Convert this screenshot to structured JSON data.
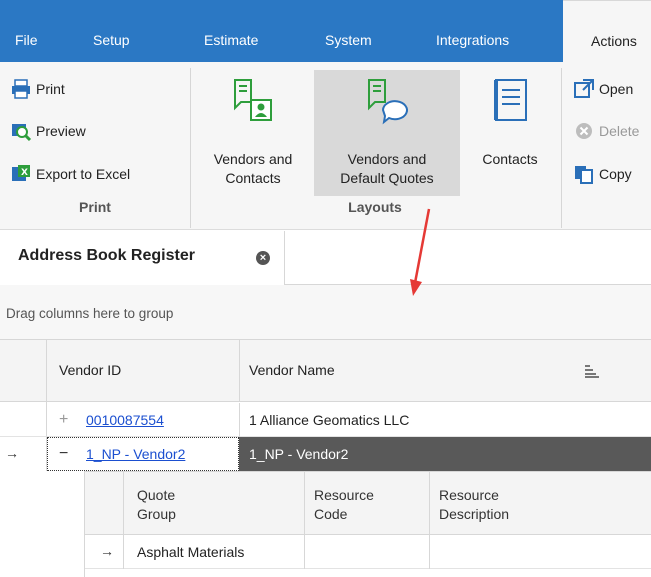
{
  "menu": {
    "items": [
      "File",
      "Setup",
      "Estimate",
      "System",
      "Integrations",
      "Actions"
    ],
    "active": "Actions"
  },
  "ribbon": {
    "print_group": {
      "buttons": [
        "Print",
        "Preview",
        "Export to Excel"
      ],
      "label": "Print"
    },
    "layouts_group": {
      "buttons": [
        "Vendors and\nContacts",
        "Vendors and\nDefault Quotes",
        "Contacts"
      ],
      "label": "Layouts"
    },
    "actions_group": {
      "buttons": [
        "Open",
        "Delete",
        "Copy"
      ]
    }
  },
  "document_tab": {
    "title": "Address Book Register",
    "close_icon": "close-icon"
  },
  "group_panel": {
    "placeholder": "Drag columns here to group"
  },
  "grid": {
    "columns": [
      "Vendor ID",
      "Vendor Name"
    ],
    "rows": [
      {
        "expander": "+",
        "vendor_id": "0010087554",
        "vendor_name": "1 Alliance Geomatics LLC"
      },
      {
        "expander": "−",
        "vendor_id": "1_NP - Vendor2",
        "vendor_name": "1_NP - Vendor2",
        "indicator": "→"
      }
    ]
  },
  "detail_grid": {
    "columns": [
      "Quote\nGroup",
      "Resource\nCode",
      "Resource\nDescription"
    ],
    "rows": [
      {
        "indicator": "→",
        "quote_group": "Asphalt Materials"
      }
    ]
  },
  "colors": {
    "menubar": "#2b78c4",
    "selected_row": "#595959",
    "annotation_arrow": "#e53935",
    "link": "#1b4fd0"
  }
}
